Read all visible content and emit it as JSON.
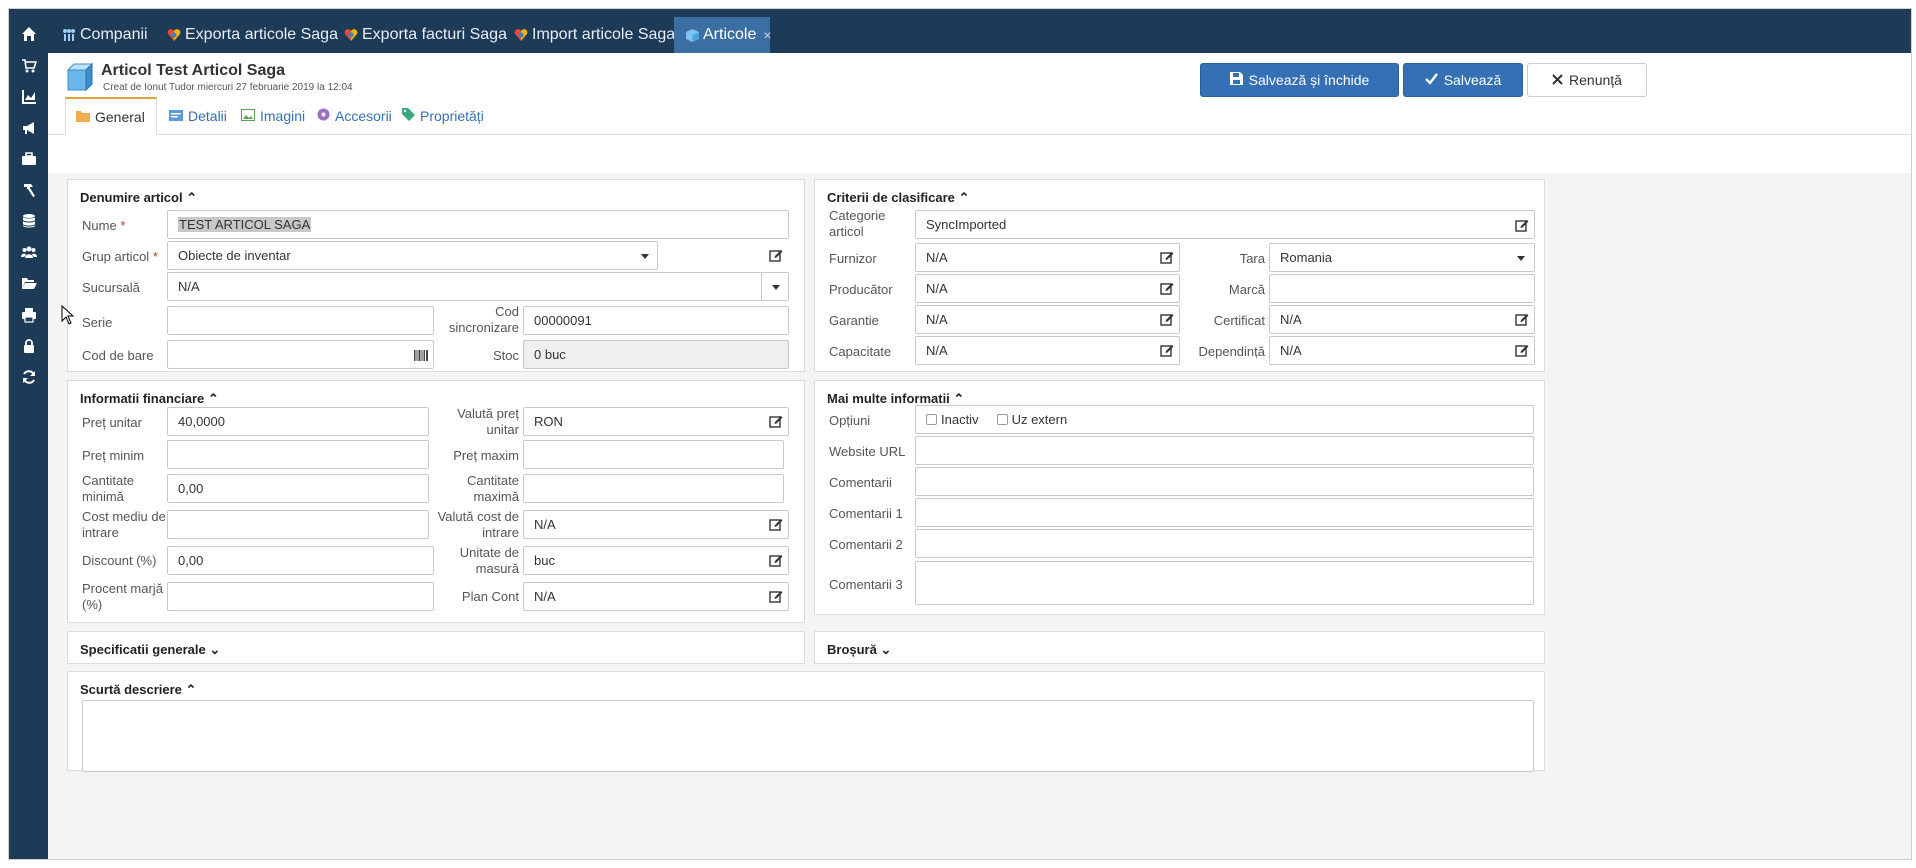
{
  "topbar": {
    "tabs": [
      {
        "label": "Companii"
      },
      {
        "label": "Exporta articole Saga"
      },
      {
        "label": "Exporta facturi Saga"
      },
      {
        "label": "Import articole Saga"
      },
      {
        "label": "Articole",
        "close": "×"
      }
    ]
  },
  "leftnav": {
    "icons": [
      "home-icon",
      "cart-icon",
      "chart-icon",
      "megaphone-icon",
      "briefcase-icon",
      "hammer-icon",
      "database-icon",
      "users-icon",
      "folder-open-icon",
      "print-icon",
      "lock-icon",
      "refresh-icon"
    ]
  },
  "header": {
    "title": "Articol Test Articol Saga",
    "subtitle": "Creat de Ionut Tudor miercuri 27 februarie 2019 la 12:04",
    "save_close": "Salvează și închide",
    "save": "Salvează",
    "cancel": "Renunță"
  },
  "subtabs": [
    "General",
    "Detalii",
    "Imagini",
    "Accesorii",
    "Proprietăți"
  ],
  "denumire": {
    "title": "Denumire articol",
    "nume_label": "Nume",
    "nume_value": "TEST ARTICOL SAGA",
    "grup_label": "Grup articol",
    "grup_value": "Obiecte de inventar",
    "sucursala_label": "Sucursală",
    "sucursala_value": "N/A",
    "serie_label": "Serie",
    "serie_value": "",
    "cod_sync_label_1": "Cod",
    "cod_sync_label_2": "sincronizare",
    "cod_sync_value": "00000091",
    "cod_bare_label": "Cod de bare",
    "cod_bare_value": "",
    "stoc_label": "Stoc",
    "stoc_value": "0 buc",
    "required_mark": "*"
  },
  "financiar": {
    "title": "Informatii financiare",
    "pret_unitar_label": "Preț unitar",
    "pret_unitar_value": "40,0000",
    "valuta_pret_label_1": "Valută preț",
    "valuta_pret_label_2": "unitar",
    "valuta_pret_value": "RON",
    "pret_minim_label": "Preț minim",
    "pret_minim_value": "",
    "pret_maxim_label": "Preț maxim",
    "pret_maxim_value": "",
    "cant_min_label_1": "Cantitate",
    "cant_min_label_2": "minimă",
    "cant_min_value": "0,00",
    "cant_max_label_1": "Cantitate",
    "cant_max_label_2": "maximă",
    "cant_max_value": "",
    "cost_mediu_label_1": "Cost mediu de",
    "cost_mediu_label_2": "intrare",
    "cost_mediu_value": "",
    "valuta_cost_label_1": "Valută cost de",
    "valuta_cost_label_2": "intrare",
    "valuta_cost_value": "N/A",
    "discount_label": "Discount (%)",
    "discount_value": "0,00",
    "unitate_label_1": "Unitate de",
    "unitate_label_2": "masură",
    "unitate_value": "buc",
    "marja_label_1": "Procent marjă",
    "marja_label_2": "(%)",
    "marja_value": "",
    "plan_cont_label": "Plan Cont",
    "plan_cont_value": "N/A"
  },
  "criterii": {
    "title": "Criterii de clasificare",
    "categorie_label_1": "Categorie",
    "categorie_label_2": "articol",
    "categorie_value": "SyncImported",
    "furnizor_label": "Furnizor",
    "furnizor_value": "N/A",
    "tara_label": "Tara",
    "tara_value": "Romania",
    "producator_label": "Producător",
    "producator_value": "N/A",
    "marca_label": "Marcă",
    "marca_value": "",
    "garantie_label": "Garantie",
    "garantie_value": "N/A",
    "certificat_label": "Certificat",
    "certificat_value": "N/A",
    "capacitate_label": "Capacitate",
    "capacitate_value": "N/A",
    "dependinta_label": "Dependință",
    "dependinta_value": "N/A"
  },
  "informatii": {
    "title": "Mai multe informatii",
    "optiuni_label": "Opțiuni",
    "inactiv_label": "Inactiv",
    "uz_extern_label": "Uz extern",
    "website_label": "Website URL",
    "comentarii_label": "Comentarii",
    "comentarii1_label": "Comentarii 1",
    "comentarii2_label": "Comentarii 2",
    "comentarii3_label": "Comentarii 3"
  },
  "sections": {
    "specificatii": "Specificatii generale",
    "brosura": "Broșură",
    "scurta": "Scurtă descriere"
  },
  "colors": {
    "nav_bg": "#1d3a57",
    "active_tab": "#3b6fa4",
    "primary_button": "#3470b3",
    "required": "#c0392b"
  }
}
